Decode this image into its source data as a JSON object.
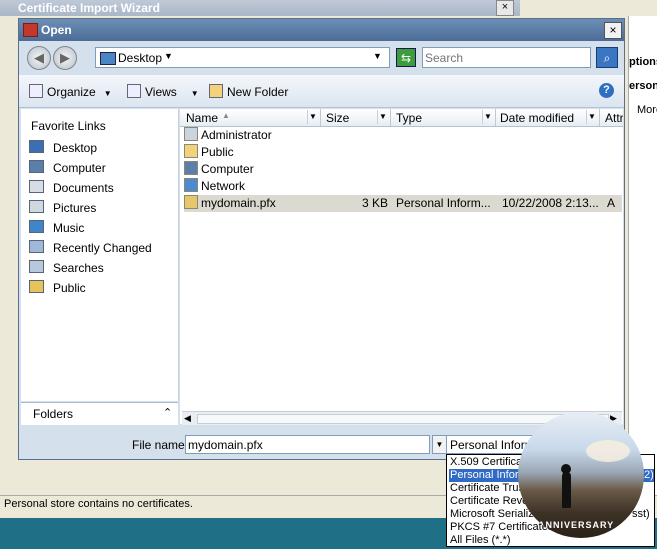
{
  "background_window": {
    "title": "Certificate Import Wizard",
    "close_label": "×",
    "right_panel": [
      "ptions",
      "ersona",
      "More"
    ],
    "status_text": "Personal store contains no certificates."
  },
  "dialog": {
    "title": "Open",
    "close_label": "×",
    "address": {
      "location": "Desktop"
    },
    "search": {
      "placeholder": "Search"
    },
    "toolbar": {
      "organize": "Organize",
      "views": "Views",
      "new_folder": "New Folder",
      "help": "?"
    },
    "nav": {
      "header": "Favorite Links",
      "items": [
        {
          "label": "Desktop",
          "icon": "desktop-icon",
          "color": "#3a6fb5"
        },
        {
          "label": "Computer",
          "icon": "computer-icon",
          "color": "#5b7fa8"
        },
        {
          "label": "Documents",
          "icon": "documents-icon",
          "color": "#d8dde3"
        },
        {
          "label": "Pictures",
          "icon": "pictures-icon",
          "color": "#cfd8e0"
        },
        {
          "label": "Music",
          "icon": "music-icon",
          "color": "#3f86c9"
        },
        {
          "label": "Recently Changed",
          "icon": "recently-changed-icon",
          "color": "#9fb8d8"
        },
        {
          "label": "Searches",
          "icon": "searches-icon",
          "color": "#b8c7da"
        },
        {
          "label": "Public",
          "icon": "public-folder-icon",
          "color": "#e8c25a"
        }
      ],
      "folders_label": "Folders"
    },
    "list": {
      "columns": [
        "Name",
        "Size",
        "Type",
        "Date modified",
        "Attr"
      ],
      "rows": [
        {
          "name": "Administrator",
          "size": "",
          "type": "",
          "date": "",
          "attr": ""
        },
        {
          "name": "Public",
          "size": "",
          "type": "",
          "date": "",
          "attr": ""
        },
        {
          "name": "Computer",
          "size": "",
          "type": "",
          "date": "",
          "attr": ""
        },
        {
          "name": "Network",
          "size": "",
          "type": "",
          "date": "",
          "attr": ""
        },
        {
          "name": "mydomain.pfx",
          "size": "3 KB",
          "type": "Personal Inform...",
          "date": "10/22/2008 2:13...",
          "attr": "A"
        }
      ]
    },
    "file_name": {
      "label": "File name:",
      "value": "mydomain.pfx"
    },
    "file_type": {
      "value": "Personal Informa"
    }
  },
  "file_type_options": [
    "X.509 Certificate",
    "Personal Inform",
    "Certificate Trus",
    "Certificate Revo",
    "Microsoft Serializ",
    "PKCS #7 Certificates",
    "All Files (*.*)"
  ],
  "file_type_options_tail": [
    "",
    "2)",
    "",
    "",
    "sst)",
    "",
    ""
  ],
  "photo_caption": "ANNIVERSARY"
}
